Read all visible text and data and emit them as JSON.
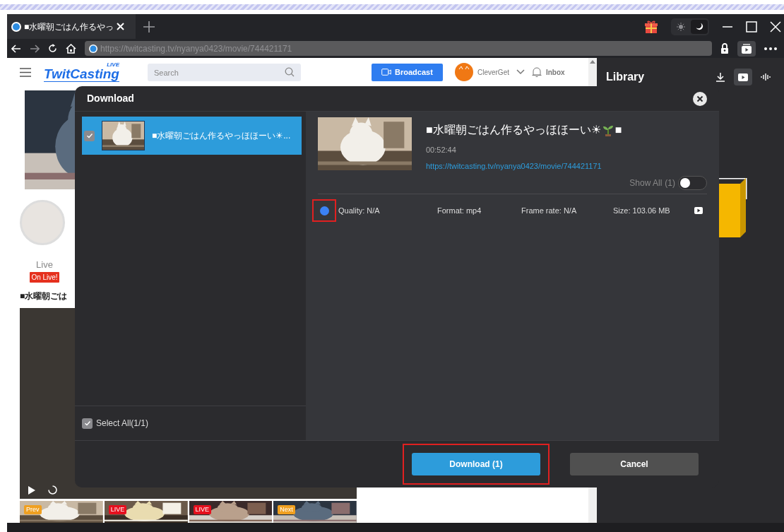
{
  "browser": {
    "tab": {
      "title": "■水曜朝ごはん作るやっ",
      "selected": true
    },
    "theme": [
      {
        "kind": "light",
        "selected": false
      },
      {
        "kind": "dark",
        "selected": true
      }
    ],
    "url": "https://twitcasting.tv/nyanya0423/movie/744421171"
  },
  "page": {
    "logo": "TwitCasting",
    "logo_tag": "LIVE",
    "search_placeholder": "Search",
    "broadcast": "Broadcast",
    "user": "CleverGet",
    "inbox": "Inbox",
    "tab_label": "Live",
    "live_badge": "On Live!",
    "title": "■水曜朝ごは",
    "thumbnails": [
      {
        "badge": "Prev",
        "kind": "nav"
      },
      {
        "badge": "LIVE",
        "kind": "live"
      },
      {
        "badge": "LIVE",
        "kind": "live"
      },
      {
        "badge": "Next",
        "kind": "nav"
      }
    ]
  },
  "library": {
    "title": "Library",
    "views": [
      {
        "kind": "download",
        "selected": false
      },
      {
        "kind": "video",
        "selected": true
      },
      {
        "kind": "audio",
        "selected": false
      }
    ]
  },
  "dialog": {
    "title": "Download",
    "items": [
      {
        "title": "■水曜朝ごはん作るやっほほーい☀...",
        "checked": true,
        "selected": true
      }
    ],
    "select_all": {
      "label": "Select All(1/1)",
      "checked": true
    },
    "detail": {
      "title": "■水曜朝ごはん作るやっほほーい☀",
      "title_end": "■",
      "duration": "00:52:44",
      "url": "https://twitcasting.tv/nyanya0423/movie/744421171",
      "show_all": {
        "label": "Show All",
        "count": "(1)",
        "on": false
      },
      "options": [
        {
          "quality": "Quality: N/A",
          "format": "Format: mp4",
          "frame_rate": "Frame rate: N/A",
          "size": "Size: 103.06 MB",
          "selected": true,
          "highlighted": true
        }
      ]
    },
    "buttons": [
      {
        "label": "Download (1)",
        "kind": "primary",
        "highlighted": true
      },
      {
        "label": "Cancel",
        "kind": "secondary",
        "highlighted": false
      }
    ]
  }
}
